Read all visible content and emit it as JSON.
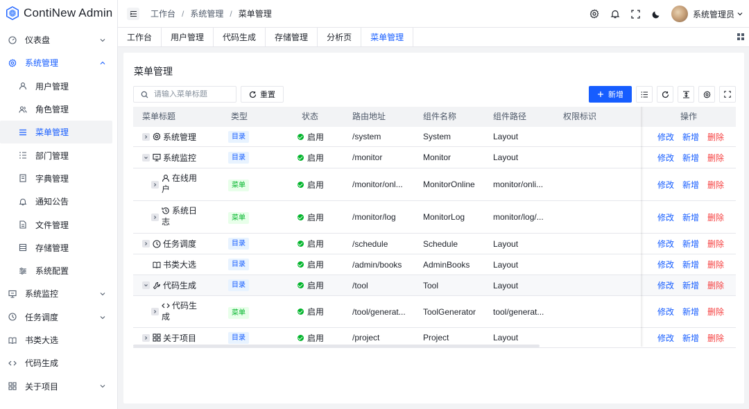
{
  "app": {
    "name": "ContiNew Admin"
  },
  "sidebar": {
    "items": [
      {
        "label": "仪表盘",
        "icon": "dashboard-icon",
        "level": "top",
        "arrow": "down"
      },
      {
        "label": "系统管理",
        "icon": "settings-icon",
        "level": "top",
        "arrow": "up",
        "open": true
      },
      {
        "label": "用户管理",
        "icon": "user-icon",
        "level": "sub"
      },
      {
        "label": "角色管理",
        "icon": "user-group-icon",
        "level": "sub"
      },
      {
        "label": "菜单管理",
        "icon": "menu-icon",
        "level": "sub",
        "active": true
      },
      {
        "label": "部门管理",
        "icon": "tree-list-icon",
        "level": "sub"
      },
      {
        "label": "字典管理",
        "icon": "book-icon",
        "level": "sub"
      },
      {
        "label": "通知公告",
        "icon": "bell-icon",
        "level": "sub"
      },
      {
        "label": "文件管理",
        "icon": "file-icon",
        "level": "sub"
      },
      {
        "label": "存储管理",
        "icon": "storage-icon",
        "level": "sub"
      },
      {
        "label": "系统配置",
        "icon": "sliders-icon",
        "level": "sub"
      },
      {
        "label": "系统监控",
        "icon": "monitor-icon",
        "level": "top",
        "arrow": "down"
      },
      {
        "label": "任务调度",
        "icon": "clock-icon",
        "level": "top",
        "arrow": "down"
      },
      {
        "label": "书类大选",
        "icon": "open-book-icon",
        "level": "top"
      },
      {
        "label": "代码生成",
        "icon": "code-icon",
        "level": "top"
      },
      {
        "label": "关于项目",
        "icon": "apps-icon",
        "level": "top",
        "arrow": "down"
      }
    ]
  },
  "header": {
    "breadcrumb": [
      "工作台",
      "系统管理",
      "菜单管理"
    ],
    "user_name": "系统管理员"
  },
  "tabs": [
    {
      "label": "工作台"
    },
    {
      "label": "用户管理"
    },
    {
      "label": "代码生成"
    },
    {
      "label": "存储管理"
    },
    {
      "label": "分析页"
    },
    {
      "label": "菜单管理",
      "active": true
    }
  ],
  "page": {
    "title": "菜单管理",
    "search_placeholder": "请输入菜单标题",
    "reset_label": "重置",
    "add_label": "新增"
  },
  "table": {
    "columns": [
      "菜单标题",
      "类型",
      "状态",
      "路由地址",
      "组件名称",
      "组件路径",
      "权限标识",
      "操作"
    ],
    "rows": [
      {
        "title": "系统管理",
        "title2": "",
        "icon": "settings-icon",
        "expand": "right",
        "indent": 0,
        "type": "目录",
        "type_kind": "dir",
        "status": "启用",
        "route": "/system",
        "component": "System",
        "path": "Layout",
        "perm": ""
      },
      {
        "title": "系统监控",
        "title2": "",
        "icon": "monitor-icon",
        "expand": "down",
        "indent": 0,
        "type": "目录",
        "type_kind": "dir",
        "status": "启用",
        "route": "/monitor",
        "component": "Monitor",
        "path": "Layout",
        "perm": ""
      },
      {
        "title": "在线用",
        "title2": "户",
        "icon": "user-icon",
        "expand": "right",
        "indent": 1,
        "type": "菜单",
        "type_kind": "menu",
        "status": "启用",
        "route": "/monitor/onl...",
        "component": "MonitorOnline",
        "path": "monitor/onli...",
        "perm": ""
      },
      {
        "title": "系统日",
        "title2": "志",
        "icon": "history-icon",
        "expand": "right",
        "indent": 1,
        "type": "菜单",
        "type_kind": "menu",
        "status": "启用",
        "route": "/monitor/log",
        "component": "MonitorLog",
        "path": "monitor/log/...",
        "perm": ""
      },
      {
        "title": "任务调度",
        "title2": "",
        "icon": "clock-icon",
        "expand": "right",
        "indent": 0,
        "type": "目录",
        "type_kind": "dir",
        "status": "启用",
        "route": "/schedule",
        "component": "Schedule",
        "path": "Layout",
        "perm": ""
      },
      {
        "title": "书类大选",
        "title2": "",
        "icon": "open-book-icon",
        "expand": "none",
        "indent": 0,
        "type": "目录",
        "type_kind": "dir",
        "status": "启用",
        "route": "/admin/books",
        "component": "AdminBooks",
        "path": "Layout",
        "perm": ""
      },
      {
        "title": "代码生成",
        "title2": "",
        "icon": "tool-icon",
        "expand": "down",
        "indent": 0,
        "type": "目录",
        "type_kind": "dir",
        "status": "启用",
        "route": "/tool",
        "component": "Tool",
        "path": "Layout",
        "perm": "",
        "highlight": true
      },
      {
        "title": "代码生",
        "title2": "成",
        "icon": "code-icon",
        "expand": "right",
        "indent": 1,
        "type": "菜单",
        "type_kind": "menu",
        "status": "启用",
        "route": "/tool/generat...",
        "component": "ToolGenerator",
        "path": "tool/generat...",
        "perm": ""
      },
      {
        "title": "关于项目",
        "title2": "",
        "icon": "apps-icon",
        "expand": "right",
        "indent": 0,
        "type": "目录",
        "type_kind": "dir",
        "status": "启用",
        "route": "/project",
        "component": "Project",
        "path": "Layout",
        "perm": ""
      }
    ],
    "op_labels": {
      "edit": "修改",
      "add": "新增",
      "delete": "删除"
    }
  },
  "colors": {
    "primary": "#165dff",
    "success": "#00b42a",
    "danger": "#f53f3f"
  }
}
